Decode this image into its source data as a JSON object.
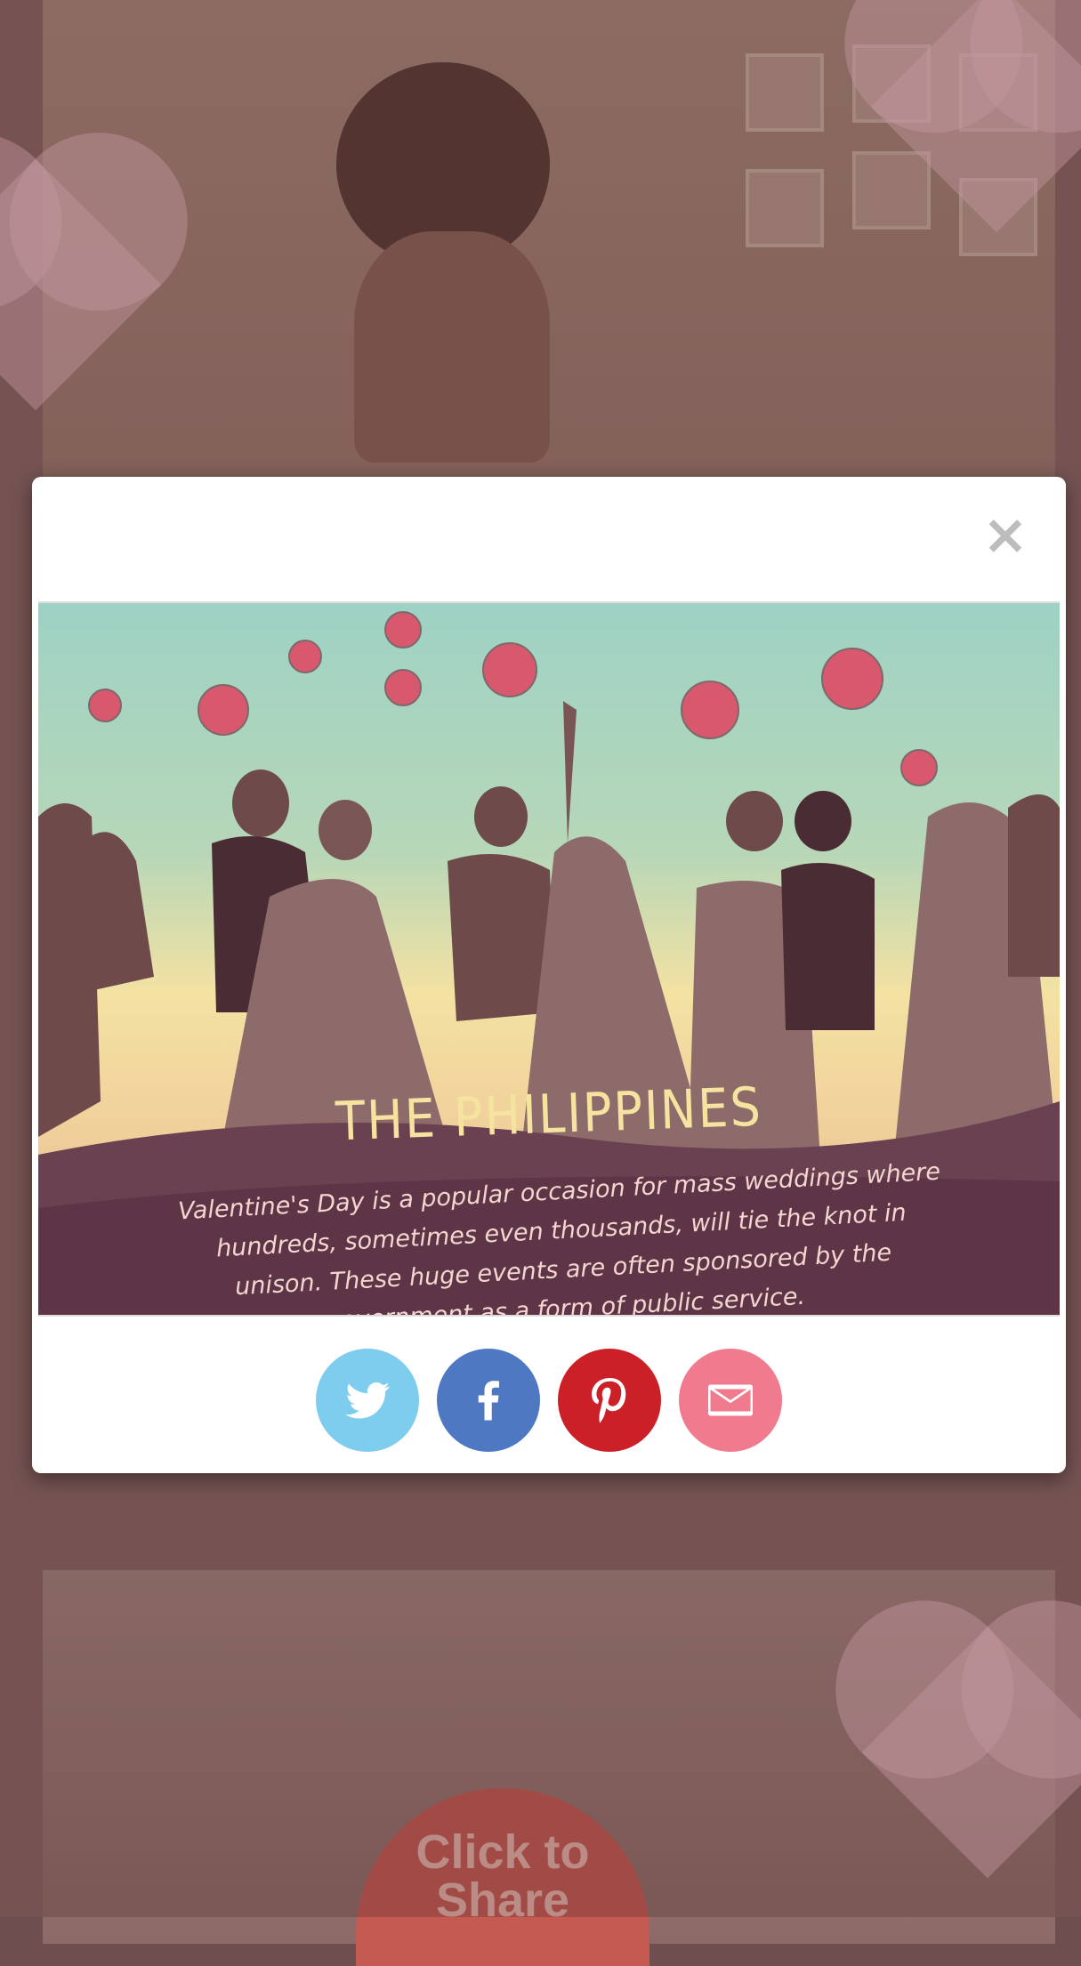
{
  "background": {
    "cta_line1": "Click to",
    "cta_line2": "Share"
  },
  "modal": {
    "close_label": "×",
    "illustration": {
      "title": "THE PHILIPPINES",
      "caption": "Valentine's Day is a popular occasion for mass weddings where hundreds, sometimes even thousands, will tie the knot in unison. These huge events are often sponsored by the government as a form of public service."
    },
    "share": [
      {
        "name": "twitter",
        "icon": "twitter-icon",
        "color": "#7fcdee"
      },
      {
        "name": "facebook",
        "icon": "facebook-icon",
        "color": "#4f78c2"
      },
      {
        "name": "pinterest",
        "icon": "pinterest-icon",
        "color": "#cc2028"
      },
      {
        "name": "email",
        "icon": "envelope-icon",
        "color": "#f07b8f"
      }
    ]
  }
}
